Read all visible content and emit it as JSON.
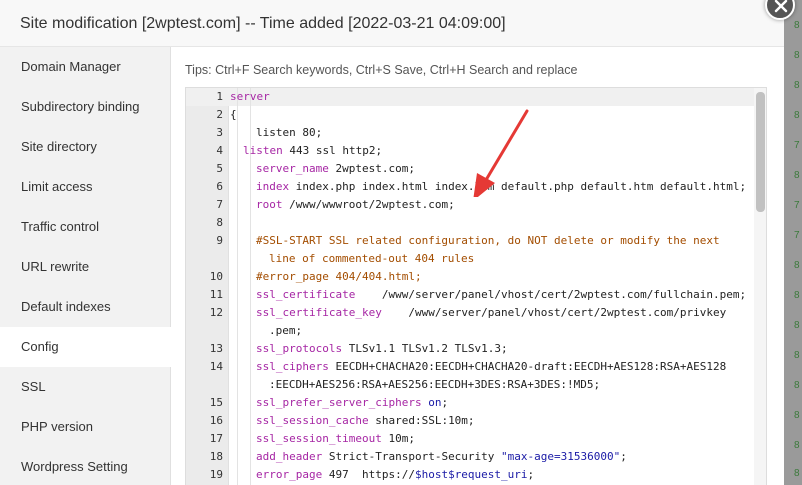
{
  "dialog": {
    "title": "Site modification [2wptest.com] -- Time added [2022-03-21 04:09:00]"
  },
  "sidebar": {
    "items": [
      {
        "label": "Domain Manager"
      },
      {
        "label": "Subdirectory binding"
      },
      {
        "label": "Site directory"
      },
      {
        "label": "Limit access"
      },
      {
        "label": "Traffic control"
      },
      {
        "label": "URL rewrite"
      },
      {
        "label": "Default indexes"
      },
      {
        "label": "Config",
        "active": true
      },
      {
        "label": "SSL"
      },
      {
        "label": "PHP version"
      },
      {
        "label": "Wordpress Setting"
      }
    ]
  },
  "editor": {
    "tips": "Tips: Ctrl+F Search keywords, Ctrl+S Save, Ctrl+H Search and replace",
    "line_numbers": [
      "1",
      "2",
      "3",
      "4",
      "5",
      "6",
      "7",
      "8",
      "9",
      "10",
      "11",
      "12",
      "13",
      "14",
      "15",
      "16",
      "17",
      "18",
      "19"
    ],
    "lines": {
      "l1": "server",
      "l2": "{",
      "l3": "listen 80;",
      "l4a": "listen",
      "l4b": " 443 ssl http2;",
      "l5a": "server_name",
      "l5b": " 2wptest.com;",
      "l6a": "index",
      "l6b": " index.php index.html index.htm default.php default.htm default.html;",
      "l7a": "root",
      "l7b": " /www/wwwroot/2wptest.com;",
      "l9a": "#SSL-START SSL related configuration, do NOT delete or modify the next",
      "l9b": "line of commented-out 404 rules",
      "l10": "#error_page 404/404.html;",
      "l11a": "ssl_certificate",
      "l11b": "    /www/server/panel/vhost/cert/2wptest.com/fullchain.pem;",
      "l12a": "ssl_certificate_key",
      "l12b": "    /www/server/panel/vhost/cert/2wptest.com/privkey",
      "l12c": ".pem;",
      "l13a": "ssl_protocols",
      "l13b": " TLSv1.1 TLSv1.2 TLSv1.3;",
      "l14a": "ssl_ciphers",
      "l14b": " EECDH+CHACHA20:EECDH+CHACHA20-draft:EECDH+AES128:RSA+AES128",
      "l14c": ":EECDH+AES256:RSA+AES256:EECDH+3DES:RSA+3DES:!MD5;",
      "l15a": "ssl_prefer_server_ciphers",
      "l15b": " on",
      "l15c": ";",
      "l16a": "ssl_session_cache",
      "l16b": " shared:SSL:10m;",
      "l17a": "ssl_session_timeout",
      "l17b": " 10m;",
      "l18a": "add_header",
      "l18b": " Strict-Transport-Security ",
      "l18c": "\"max-age=31536000\"",
      "l18d": ";",
      "l19a": "error_page",
      "l19b": " 497  https://",
      "l19c": "$host$request_uri",
      "l19d": ";"
    }
  },
  "background": {
    "cells": [
      "8",
      "8",
      "8",
      "8",
      "7",
      "8",
      "7",
      "7",
      "8",
      "8",
      "8",
      "8",
      "8",
      "8",
      "8",
      "8"
    ]
  },
  "colors": {
    "keyword": "#a626a4",
    "string": "#1a1aa6",
    "comment": "#a34d00",
    "annotation_arrow": "#e53935"
  }
}
